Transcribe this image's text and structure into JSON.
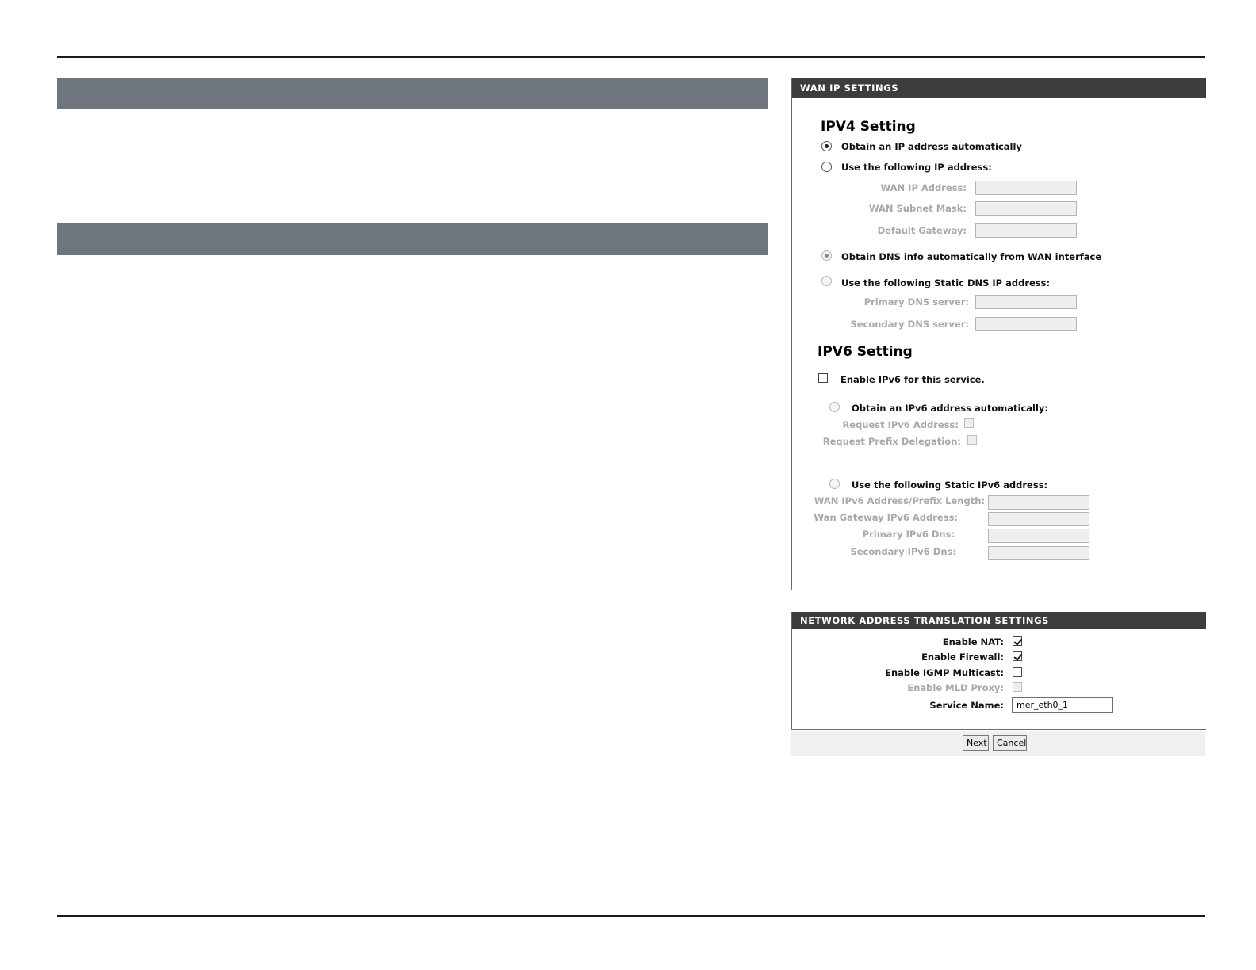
{
  "wan_panel": {
    "title": "WAN IP SETTINGS",
    "ipv4": {
      "heading": "IPV4 Setting",
      "obtain_auto": "Obtain an IP address automatically",
      "use_following": "Use the following IP address:",
      "wan_ip_label": "WAN IP Address:",
      "wan_mask_label": "WAN Subnet Mask:",
      "gateway_label": "Default Gateway:",
      "dns_auto": "Obtain DNS info automatically from WAN interface",
      "dns_static": "Use the following Static DNS IP address:",
      "primary_dns_label": "Primary DNS server:",
      "secondary_dns_label": "Secondary DNS server:"
    },
    "ipv6": {
      "heading": "IPV6 Setting",
      "enable": "Enable IPv6 for this service.",
      "obtain_auto": "Obtain an IPv6 address automatically:",
      "request_addr_label": "Request IPv6 Address:",
      "request_prefix_label": "Request Prefix Delegation:",
      "use_static": "Use the following Static IPv6 address:",
      "wan_addr_prefix_label": "WAN IPv6 Address/Prefix Length:",
      "wan_gateway_label": "Wan Gateway IPv6 Address:",
      "primary_dns_label": "Primary IPv6 Dns:",
      "secondary_dns_label": "Secondary IPv6 Dns:"
    }
  },
  "nat_panel": {
    "title": "NETWORK ADDRESS TRANSLATION SETTINGS",
    "enable_nat_label": "Enable NAT:",
    "enable_firewall_label": "Enable Firewall:",
    "enable_igmp_label": "Enable IGMP Multicast:",
    "enable_mld_label": "Enable MLD Proxy:",
    "service_name_label": "Service Name:",
    "service_name_value": "mer_eth0_1"
  },
  "buttons": {
    "next": "Next",
    "cancel": "Cancel"
  }
}
